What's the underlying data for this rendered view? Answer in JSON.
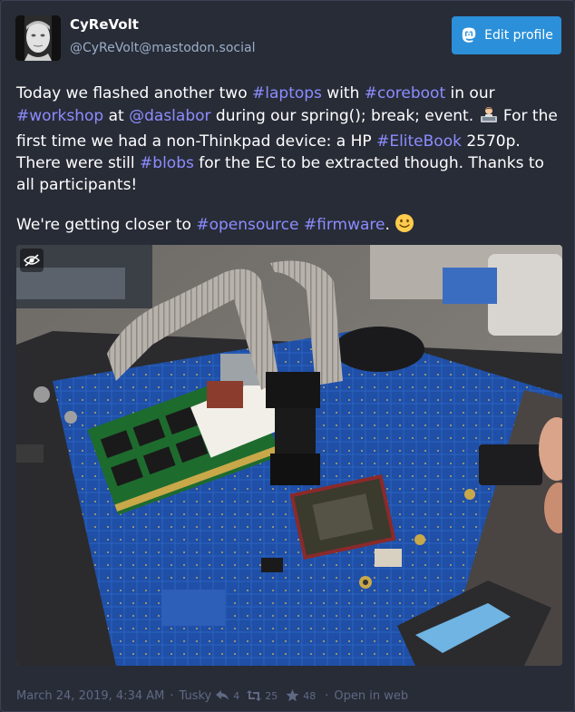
{
  "author": {
    "display_name": "CyReVolt",
    "acct": "@CyReVolt@mastodon.social"
  },
  "actions": {
    "edit_profile_label": "Edit profile"
  },
  "status": {
    "p1": {
      "t1": "Today we flashed another two ",
      "h_laptops": "#laptops",
      "t2": " with ",
      "h_coreboot": "#coreboot",
      "t3": " in our ",
      "h_workshop": "#workshop",
      "t4": " at ",
      "m_daslabor": "@daslabor",
      "t5": " during our spring(); break; event. ",
      "t6": " For the first time we had a non-Thinkpad device: a HP ",
      "h_elitebook": "#EliteBook",
      "t7": " 2570p. There were still ",
      "h_blobs": "#blobs",
      "t8": " for the EC to be extracted though. Thanks to all participants!"
    },
    "p2": {
      "t1": "We're getting closer to ",
      "h_opensource": "#opensource",
      "t2": " ",
      "h_firmware": "#firmware",
      "t3": ". "
    }
  },
  "media": {
    "icon": "eye-slash-icon"
  },
  "meta": {
    "date": "March 24, 2019, 4:34 AM",
    "separator": "·",
    "application": "Tusky",
    "replies": "4",
    "boosts": "25",
    "favourites": "48",
    "open_in_web": "Open in web"
  },
  "colors": {
    "background": "#282c37",
    "accent_button": "#2b90d9",
    "link": "#8c8dff",
    "muted": "#606984",
    "handle": "#9baec8"
  }
}
